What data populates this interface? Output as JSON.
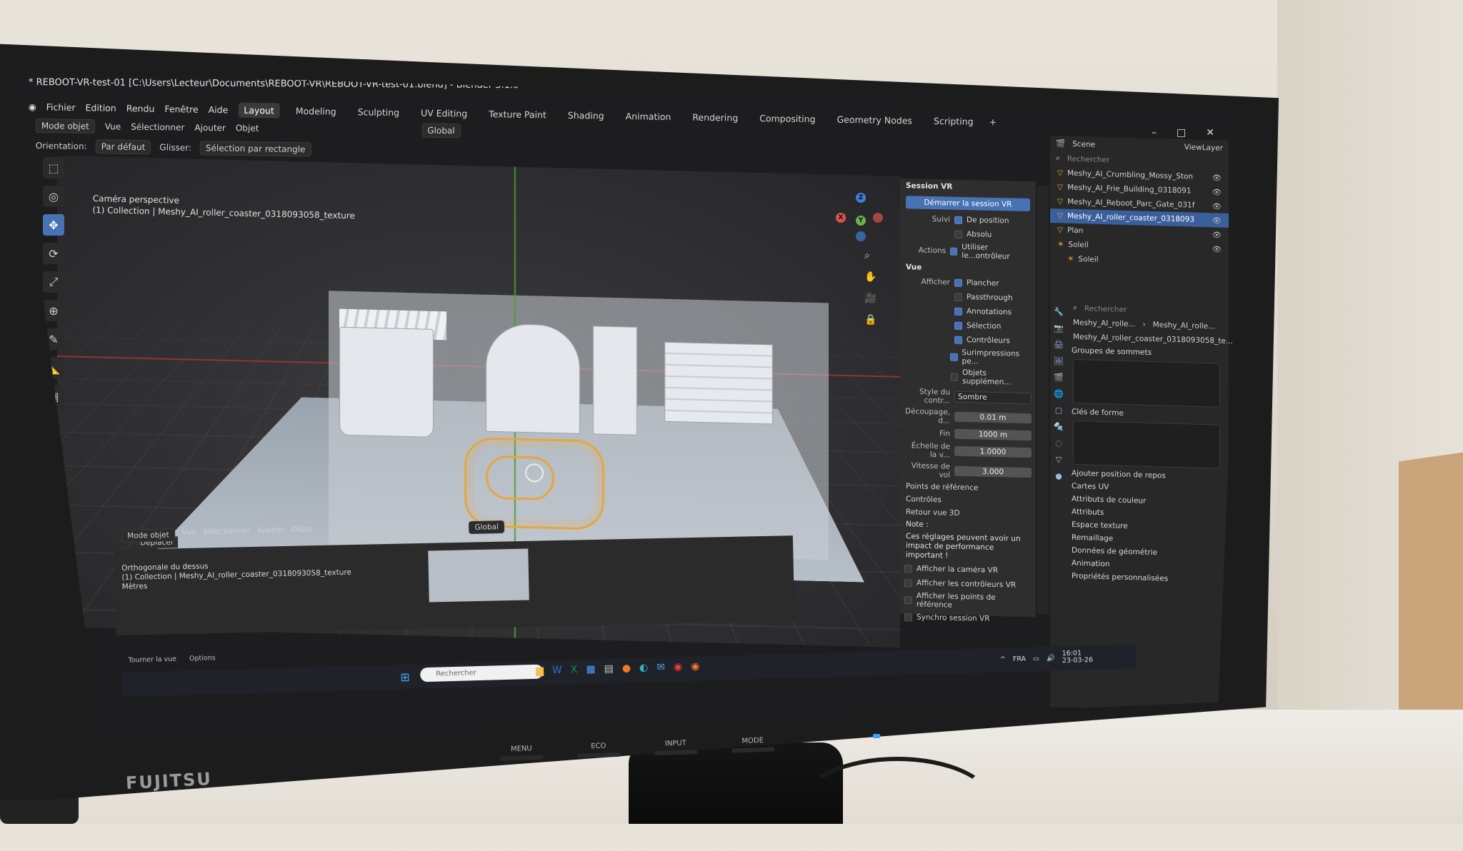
{
  "window": {
    "title": "* REBOOT-VR-test-01 [C:\\Users\\Lecteur\\Documents\\REBOOT-VR\\REBOOT-VR-test-01.blend] - Blender 5.1.0"
  },
  "menu": [
    "Fichier",
    "Edition",
    "Rendu",
    "Fenêtre",
    "Aide"
  ],
  "workspaces": [
    {
      "label": "Layout",
      "active": true
    },
    {
      "label": "Modeling"
    },
    {
      "label": "Sculpting"
    },
    {
      "label": "UV Editing"
    },
    {
      "label": "Texture Paint"
    },
    {
      "label": "Shading"
    },
    {
      "label": "Animation"
    },
    {
      "label": "Rendering"
    },
    {
      "label": "Compositing"
    },
    {
      "label": "Geometry Nodes"
    },
    {
      "label": "Scripting"
    }
  ],
  "add_workspace": "+",
  "header3d": {
    "mode": "Mode objet",
    "vue": "Vue",
    "selectionner": "Sélectionner",
    "ajouter": "Ajouter",
    "objet": "Objet",
    "transform_orientation": "Global",
    "orientation_label": "Orientation:",
    "orientation_value": "Par défaut",
    "glisser_label": "Glisser:",
    "glisser_value": "Sélection par rectangle"
  },
  "viewport": {
    "overlay_line1": "Caméra perspective",
    "overlay_line2": "(1) Collection | Meshy_AI_roller_coaster_0318093058_texture"
  },
  "npanel": {
    "session_header": "Session VR",
    "start_button": "Démarrer la session VR",
    "suivi_label": "Suivi",
    "de_position": "De position",
    "absolu": "Absolu",
    "actions_label": "Actions",
    "utiliser_controleur": "Utiliser le...ontrôleur",
    "vue_header": "Vue",
    "afficher_label": "Afficher",
    "afficher_items": [
      {
        "label": "Plancher",
        "checked": true
      },
      {
        "label": "Passthrough",
        "checked": false
      },
      {
        "label": "Annotations",
        "checked": true
      },
      {
        "label": "Sélection",
        "checked": true
      },
      {
        "label": "Contrôleurs",
        "checked": true
      },
      {
        "label": "Surimpressions pe...",
        "checked": true
      },
      {
        "label": "Objets supplémen...",
        "checked": false
      }
    ],
    "style_label": "Style du contr...",
    "style_value": "Sombre",
    "decoupage_label": "Découpage, d...",
    "decoupage_value": "0.01 m",
    "fin_label": "Fin",
    "fin_value": "1000 m",
    "echelle_label": "Échelle de la v...",
    "echelle_value": "1.0000",
    "vitesse_label": "Vitesse de vol",
    "vitesse_value": "3.000",
    "points_reference": "Points de référence",
    "controles": "Contrôles",
    "retour_vue": "Retour vue 3D",
    "note_title": "Note :",
    "note_text": "Ces réglages peuvent avoir un impact de performance important !",
    "retour_items": [
      "Afficher la caméra VR",
      "Afficher les contrôleurs VR",
      "Afficher les points de référence",
      "Synchro session VR"
    ]
  },
  "outliner": {
    "scene": "Scene",
    "view_layer": "ViewLayer",
    "search_placeholder": "Rechercher",
    "items": [
      {
        "label": "Meshy_AI_Crumbling_Mossy_Ston",
        "selected": false
      },
      {
        "label": "Meshy_AI_Frie_Building_0318091",
        "selected": false
      },
      {
        "label": "Meshy_AI_Reboot_Parc_Gate_031f",
        "selected": false
      },
      {
        "label": "Meshy_AI_roller_coaster_0318093",
        "selected": true
      },
      {
        "label": "Plan",
        "selected": false
      },
      {
        "label": "Soleil",
        "selected": false
      },
      {
        "label": "Soleil",
        "selected": false
      }
    ]
  },
  "properties": {
    "search_placeholder": "Rechercher",
    "breadcrumb_1": "Meshy_AI_rolle...",
    "breadcrumb_2": "Meshy_AI_rolle...",
    "mesh_name": "Meshy_AI_roller_coaster_0318093058_te...",
    "groupes_sommets": "Groupes de sommets",
    "cles_forme": "Clés de forme",
    "ajouter_position": "Ajouter position de repos",
    "sections": [
      "Cartes UV",
      "Attributs de couleur",
      "Attributs",
      "Espace texture",
      "Remaillage",
      "Données de géométrie",
      "Animation",
      "Propriétés personnalisées"
    ]
  },
  "lower_area": {
    "deplacer": "Déplacer",
    "mode": "Mode objet",
    "vue": "Vue",
    "selectionner": "Sélectionner",
    "ajouter": "Ajouter",
    "objet": "Objet",
    "transform": "Global",
    "line1": "Orthogonale du dessus",
    "line2": "(1) Collection | Meshy_AI_roller_coaster_0318093058_texture",
    "line3": "Mètres"
  },
  "statusbar": {
    "item1": "Tourner la vue",
    "item2": "Options"
  },
  "taskbar": {
    "search_placeholder": "Rechercher",
    "lang": "FRA",
    "time": "16:01",
    "date": "23-03-26"
  },
  "monitor": {
    "brand": "FUJITSU",
    "buttons": [
      "MENU",
      "ECO",
      "INPUT",
      "MODE"
    ]
  }
}
